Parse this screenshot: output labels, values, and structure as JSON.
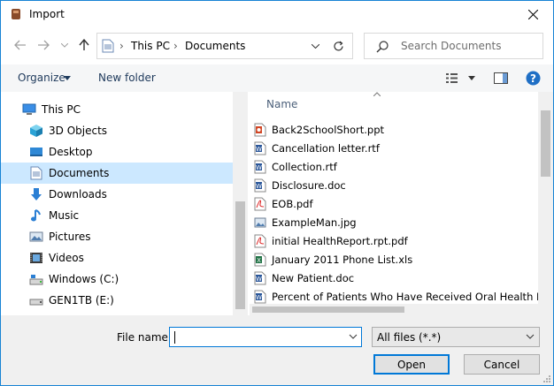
{
  "window": {
    "title": "Import"
  },
  "address": {
    "crumbs": [
      "This PC",
      "Documents"
    ]
  },
  "search": {
    "placeholder": "Search Documents"
  },
  "toolbar": {
    "organize": "Organize",
    "new_folder": "New folder"
  },
  "nav": {
    "items": [
      {
        "label": "This PC",
        "icon": "pc-icon"
      },
      {
        "label": "3D Objects",
        "icon": "3d-objects-icon"
      },
      {
        "label": "Desktop",
        "icon": "desktop-icon"
      },
      {
        "label": "Documents",
        "icon": "documents-icon"
      },
      {
        "label": "Downloads",
        "icon": "downloads-icon"
      },
      {
        "label": "Music",
        "icon": "music-icon"
      },
      {
        "label": "Pictures",
        "icon": "pictures-icon"
      },
      {
        "label": "Videos",
        "icon": "videos-icon"
      },
      {
        "label": "Windows (C:)",
        "icon": "drive-icon"
      },
      {
        "label": "GEN1TB (E:)",
        "icon": "drive-icon"
      }
    ]
  },
  "files": {
    "column_name": "Name",
    "rows": [
      {
        "name": "Back2SchoolShort.ppt",
        "icon": "ppt-icon"
      },
      {
        "name": "Cancellation letter.rtf",
        "icon": "word-icon"
      },
      {
        "name": "Collection.rtf",
        "icon": "word-icon"
      },
      {
        "name": "Disclosure.doc",
        "icon": "word-icon"
      },
      {
        "name": "EOB.pdf",
        "icon": "pdf-icon"
      },
      {
        "name": "ExampleMan.jpg",
        "icon": "image-icon"
      },
      {
        "name": "initial HealthReport.rpt.pdf",
        "icon": "pdf-icon"
      },
      {
        "name": "January 2011 Phone List.xls",
        "icon": "excel-icon"
      },
      {
        "name": "New Patient.doc",
        "icon": "word-icon"
      },
      {
        "name": "Percent of Patients Who Have Received Oral Health Edu...",
        "icon": "word-icon"
      }
    ]
  },
  "bottom": {
    "file_name_label": "File name:",
    "file_name_value": "",
    "filter": "All files (*.*)",
    "open": "Open",
    "cancel": "Cancel"
  },
  "colors": {
    "accent": "#0078d7",
    "selected": "#cce8ff"
  }
}
